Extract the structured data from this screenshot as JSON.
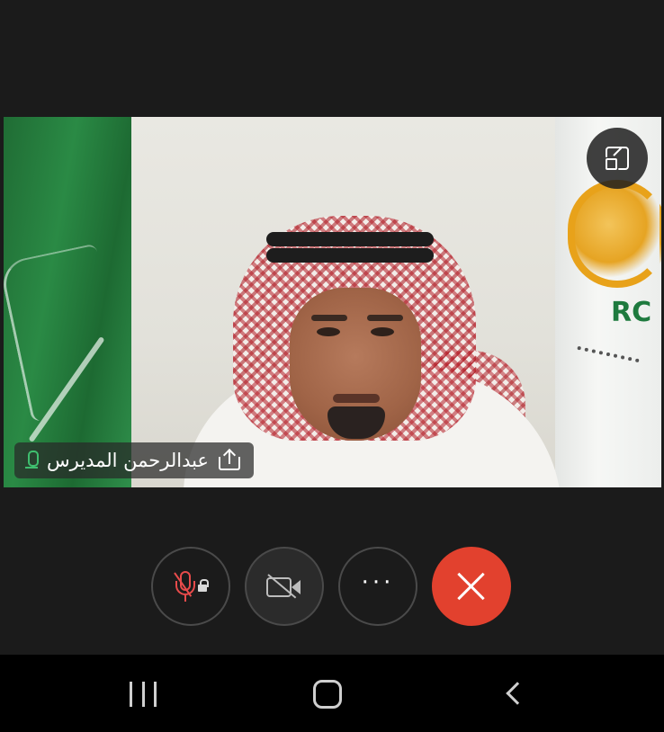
{
  "participant": {
    "name": "عبدالرحمن المديرس",
    "mic_icon": "mic-active-icon",
    "share_icon": "share-screen-icon"
  },
  "video": {
    "minimize_icon": "minimize-window-icon"
  },
  "controls": [
    {
      "name": "microphone",
      "state": "muted-locked",
      "icon": "mic-muted-lock-icon",
      "color": "#e84b4b"
    },
    {
      "name": "camera",
      "state": "off",
      "icon": "camera-off-icon",
      "color": "#bdbdbd"
    },
    {
      "name": "more",
      "label": "···",
      "icon": "more-options-icon"
    },
    {
      "name": "end-call",
      "icon": "close-icon",
      "color": "#e2412e"
    }
  ],
  "navbar": {
    "recents_icon": "recents-icon",
    "home_icon": "home-icon",
    "back_icon": "back-icon"
  },
  "colors": {
    "background": "#1b1b1b",
    "end_call": "#e2412e",
    "muted": "#e84b4b",
    "active_mic": "#3fbf6f"
  }
}
